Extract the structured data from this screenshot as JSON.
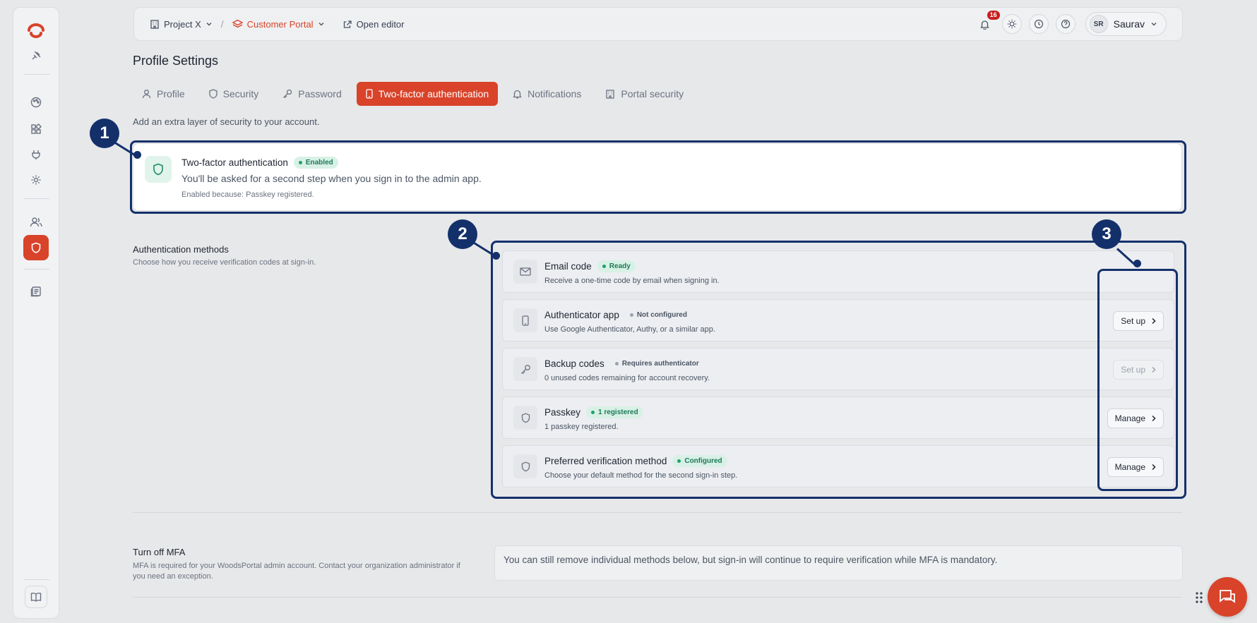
{
  "topbar": {
    "project_label": "Project X",
    "separator": "/",
    "portal_label": "Customer Portal",
    "open_editor_label": "Open editor",
    "notification_count": "16",
    "user_initials": "SR",
    "user_name": "Saurav"
  },
  "page": {
    "title": "Profile Settings",
    "tabs": [
      {
        "label": "Profile"
      },
      {
        "label": "Security"
      },
      {
        "label": "Password"
      },
      {
        "label": "Two-factor authentication"
      },
      {
        "label": "Notifications"
      },
      {
        "label": "Portal security"
      }
    ],
    "subtitle": "Add an extra layer of security to your account."
  },
  "status_card": {
    "title": "Two-factor authentication",
    "badge": "Enabled",
    "description": "You'll be asked for a second step when you sign in to the admin app.",
    "note": "Enabled because: Passkey registered."
  },
  "auth_methods": {
    "title": "Authentication methods",
    "description": "Choose how you receive verification codes at sign-in.",
    "items": [
      {
        "title": "Email code",
        "badge": "Ready",
        "description": "Receive a one-time code by email when signing in.",
        "action": ""
      },
      {
        "title": "Authenticator app",
        "badge": "Not configured",
        "description": "Use Google Authenticator, Authy, or a similar app.",
        "action": "Set up"
      },
      {
        "title": "Backup codes",
        "badge": "Requires authenticator",
        "description": "0 unused codes remaining for account recovery.",
        "action": "Set up"
      },
      {
        "title": "Passkey",
        "badge": "1 registered",
        "description": "1 passkey registered.",
        "action": "Manage"
      },
      {
        "title": "Preferred verification method",
        "badge": "Configured",
        "description": "Choose your default method for the second sign-in step.",
        "action": "Manage"
      }
    ]
  },
  "mfa_off": {
    "title": "Turn off MFA",
    "description": "MFA is required for your WoodsPortal admin account. Contact your organization administrator if you need an exception.",
    "notice": "You can still remove individual methods below, but sign-in will continue to require verification while MFA is mandatory."
  },
  "annotations": [
    "1",
    "2",
    "3"
  ],
  "colors": {
    "accent": "#d8432a",
    "annotation": "#14306b",
    "success": "#22a06b"
  }
}
